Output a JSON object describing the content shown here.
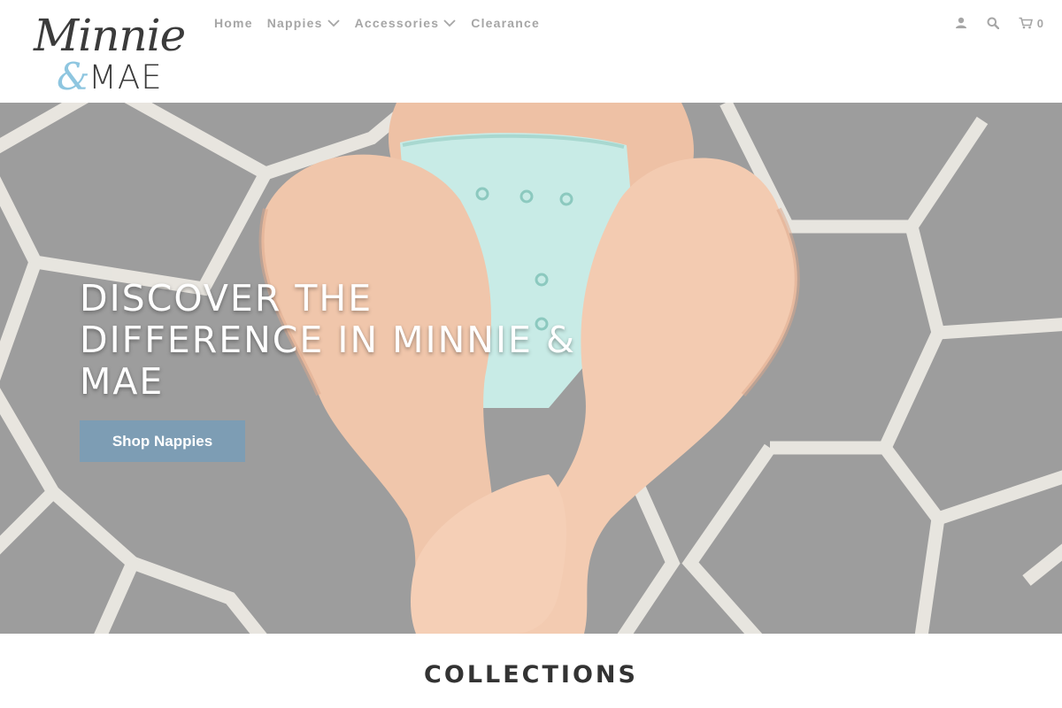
{
  "brand": {
    "logo_script": "Minnie",
    "logo_amp": "&",
    "logo_word": "MAE"
  },
  "nav": {
    "items": [
      {
        "label": "Home",
        "has_dropdown": false
      },
      {
        "label": "Nappies",
        "has_dropdown": true
      },
      {
        "label": "Accessories",
        "has_dropdown": true
      },
      {
        "label": "Clearance",
        "has_dropdown": false
      }
    ]
  },
  "utility": {
    "account_icon": "user-icon",
    "search_icon": "search-icon",
    "cart_icon": "cart-icon",
    "cart_count": "0"
  },
  "hero": {
    "heading": "DISCOVER THE DIFFERENCE IN MINNIE & MAE",
    "button_label": "Shop Nappies",
    "button_color": "#7d9db4"
  },
  "collections": {
    "title": "COLLECTIONS"
  },
  "colors": {
    "nav_text": "#a6a6a6",
    "accent_blue": "#8ec6e0",
    "mat_gray": "#9b9b9b",
    "nappy_mint": "#c8ebe6"
  }
}
